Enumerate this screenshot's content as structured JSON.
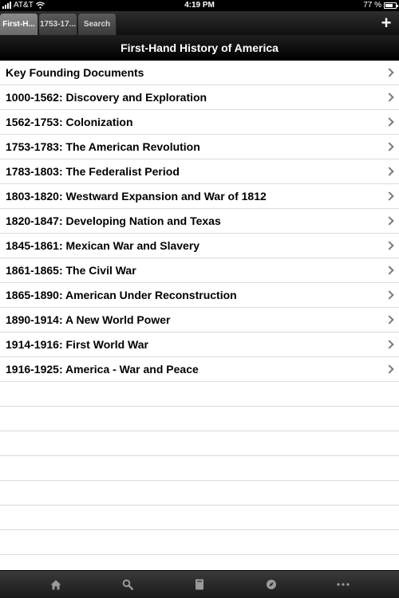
{
  "status_bar": {
    "carrier": "AT&T",
    "time": "4:19 PM",
    "battery": "77 %",
    "battery_level": 0.77
  },
  "tabs": [
    {
      "label": "First-H...",
      "active": true
    },
    {
      "label": "1753-17...",
      "active": false
    },
    {
      "label": "Search",
      "active": false
    }
  ],
  "nav": {
    "title": "First-Hand History of America"
  },
  "list": {
    "items": [
      "Key Founding Documents",
      "1000-1562: Discovery and Exploration",
      "1562-1753: Colonization",
      "1753-1783: The American Revolution",
      "1783-1803: The Federalist Period",
      "1803-1820: Westward Expansion and War of 1812",
      "1820-1847: Developing Nation and Texas",
      "1845-1861: Mexican War and Slavery",
      "1861-1865: The Civil War",
      "1865-1890: American Under Reconstruction",
      "1890-1914: A New World Power",
      "1914-1916: First World War",
      "1916-1925: America - War and Peace"
    ]
  },
  "toolbar": {
    "icons": [
      "home-icon",
      "search-icon",
      "book-icon",
      "compass-icon",
      "more-icon"
    ]
  }
}
